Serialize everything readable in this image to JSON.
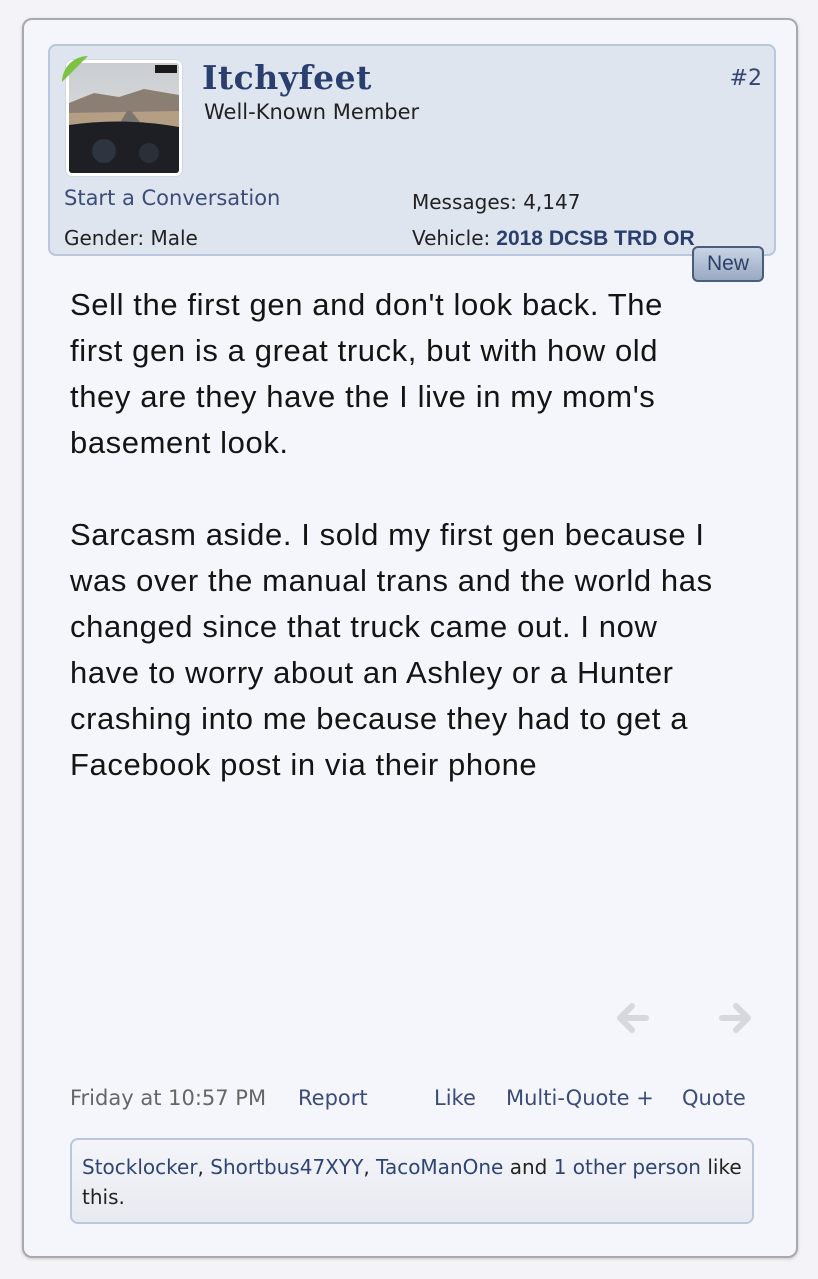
{
  "user": {
    "name": "Itchyfeet",
    "title": "Well-Known Member",
    "post_number": "#2",
    "start_conversation": "Start a Conversation",
    "gender_label": "Gender:",
    "gender_value": "Male",
    "messages_label": "Messages:",
    "messages_value": "4,147",
    "vehicle_label": "Vehicle:",
    "vehicle_value": "2018 DCSB TRD OR",
    "new_badge": "New"
  },
  "post": {
    "paragraphs": [
      "Sell the first gen and don't look back. The first gen is a great truck, but with how old they are they have the I live in my mom's basement look.",
      "Sarcasm aside. I sold my first gen because I was over the manual trans and the world has changed since that truck came out. I now have to worry about an Ashley or a Hunter crashing into me because they had to get a Facebook post in via their phone"
    ]
  },
  "footer": {
    "date": "Friday at 10:57 PM",
    "report": "Report",
    "like": "Like",
    "multi_quote": "Multi-Quote +",
    "quote": "Quote"
  },
  "likes": {
    "user1": "Stocklocker",
    "sep1": ", ",
    "user2": "Shortbus47XYY",
    "sep2": ", ",
    "user3": "TacoManOne",
    "and_text": " and ",
    "other_count": "1 other",
    "person": "person",
    "suffix": " like this."
  },
  "colors": {
    "accent": "#2a3f6e",
    "link": "#3c4c78",
    "card_bg": "#f5f6fc",
    "userbox_bg": "#dfe5ef",
    "online_badge": "#7cc243"
  },
  "icons": {
    "prev": "arrow-left-icon",
    "next": "arrow-right-icon"
  }
}
